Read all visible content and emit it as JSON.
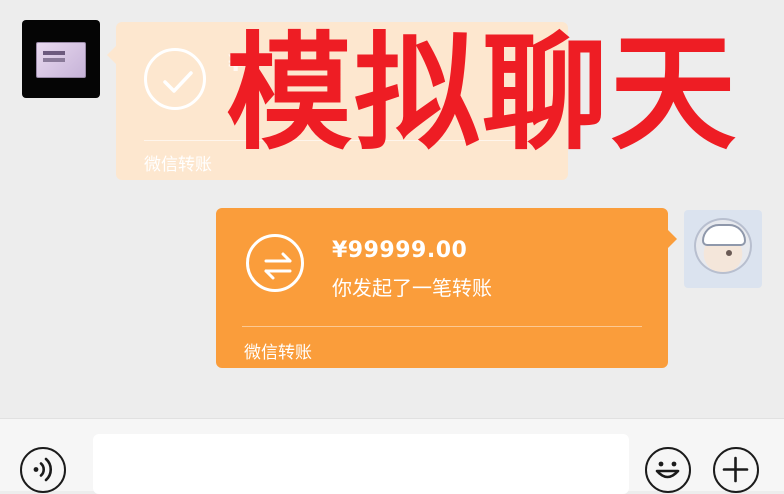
{
  "overlay": {
    "title": "模拟聊天"
  },
  "messages": {
    "received_transfer": {
      "amount": "¥",
      "footer": "微信转账"
    },
    "sent_transfer": {
      "amount": "¥99999.00",
      "status": "你发起了一笔转账",
      "footer": "微信转账"
    }
  },
  "icons": {
    "received_status": "check-icon",
    "sent_status": "transfer-arrows-icon",
    "voice": "voice-icon",
    "emoji": "emoji-icon",
    "plus": "plus-icon"
  },
  "colors": {
    "background": "#ededed",
    "transfer_orange": "#fa9d3b",
    "transfer_faded": "#fde7cf",
    "overlay_red": "#ee1d24",
    "input_bar": "#f6f6f6"
  },
  "input": {
    "value": ""
  }
}
